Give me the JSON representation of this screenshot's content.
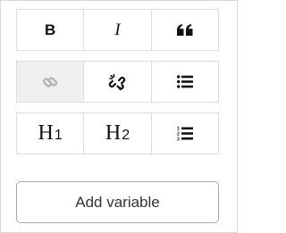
{
  "toolbar": {
    "bold": {
      "label": "B",
      "icon": "bold-icon"
    },
    "italic": {
      "label": "I",
      "icon": "italic-icon"
    },
    "quote": {
      "icon": "quote-icon"
    },
    "link": {
      "icon": "link-icon",
      "disabled": true
    },
    "unlink": {
      "icon": "unlink-icon"
    },
    "bullet_list": {
      "icon": "bullet-list-icon"
    },
    "heading1": {
      "letter": "H",
      "number": "1",
      "icon": "heading-1-icon"
    },
    "heading2": {
      "letter": "H",
      "number": "2",
      "icon": "heading-2-icon"
    },
    "numbered_list": {
      "icon": "numbered-list-icon"
    }
  },
  "add_variable": {
    "label": "Add variable"
  },
  "colors": {
    "icon": "#111111",
    "icon_disabled": "#b5b5b5",
    "disabled_bg": "#f0f0f0",
    "border": "#dddddd",
    "button_border": "#a9a9a9",
    "button_text": "#333333"
  }
}
